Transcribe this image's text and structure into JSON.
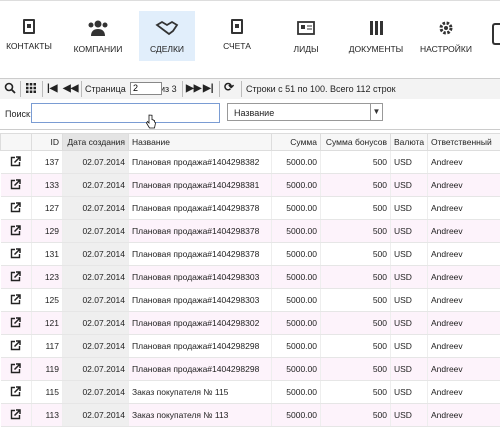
{
  "nav": {
    "items": [
      {
        "label": "КОНТАКТЫ",
        "icon": "contact-book-icon"
      },
      {
        "label": "КОМПАНИИ",
        "icon": "group-icon"
      },
      {
        "label": "СДЕЛКИ",
        "icon": "handshake-icon"
      },
      {
        "label": "СЧЕТА",
        "icon": "invoice-icon"
      },
      {
        "label": "ЛИДЫ",
        "icon": "lead-card-icon"
      },
      {
        "label": "ДОКУМЕНТЫ",
        "icon": "documents-icon"
      },
      {
        "label": "НАСТРОЙКИ",
        "icon": "gear-icon"
      }
    ],
    "active_index": 2
  },
  "toolbar": {
    "page_label": "Страница",
    "page_value": "2",
    "page_of": "из 3",
    "status": "Строки с 51 по 100. Всего 112 строк"
  },
  "search": {
    "label": "Поиск:",
    "value": "",
    "field_select": "Название"
  },
  "table": {
    "columns": [
      "ID",
      "Дата создания",
      "Название",
      "Сумма",
      "Сумма бонусов",
      "Валюта",
      "Ответственный"
    ],
    "rows": [
      {
        "id": "137",
        "date": "02.07.2014",
        "name": "Плановая продажа#1404298382",
        "sum": "5000.00",
        "bonus": "500",
        "currency": "USD",
        "resp": "Andreev"
      },
      {
        "id": "133",
        "date": "02.07.2014",
        "name": "Плановая продажа#1404298381",
        "sum": "5000.00",
        "bonus": "500",
        "currency": "USD",
        "resp": "Andreev"
      },
      {
        "id": "127",
        "date": "02.07.2014",
        "name": "Плановая продажа#1404298378",
        "sum": "5000.00",
        "bonus": "500",
        "currency": "USD",
        "resp": "Andreev"
      },
      {
        "id": "129",
        "date": "02.07.2014",
        "name": "Плановая продажа#1404298378",
        "sum": "5000.00",
        "bonus": "500",
        "currency": "USD",
        "resp": "Andreev"
      },
      {
        "id": "131",
        "date": "02.07.2014",
        "name": "Плановая продажа#1404298378",
        "sum": "5000.00",
        "bonus": "500",
        "currency": "USD",
        "resp": "Andreev"
      },
      {
        "id": "123",
        "date": "02.07.2014",
        "name": "Плановая продажа#1404298303",
        "sum": "5000.00",
        "bonus": "500",
        "currency": "USD",
        "resp": "Andreev"
      },
      {
        "id": "125",
        "date": "02.07.2014",
        "name": "Плановая продажа#1404298303",
        "sum": "5000.00",
        "bonus": "500",
        "currency": "USD",
        "resp": "Andreev"
      },
      {
        "id": "121",
        "date": "02.07.2014",
        "name": "Плановая продажа#1404298302",
        "sum": "5000.00",
        "bonus": "500",
        "currency": "USD",
        "resp": "Andreev"
      },
      {
        "id": "117",
        "date": "02.07.2014",
        "name": "Плановая продажа#1404298298",
        "sum": "5000.00",
        "bonus": "500",
        "currency": "USD",
        "resp": "Andreev"
      },
      {
        "id": "119",
        "date": "02.07.2014",
        "name": "Плановая продажа#1404298298",
        "sum": "5000.00",
        "bonus": "500",
        "currency": "USD",
        "resp": "Andreev"
      },
      {
        "id": "115",
        "date": "02.07.2014",
        "name": "Заказ покупателя № 115",
        "sum": "5000.00",
        "bonus": "500",
        "currency": "USD",
        "resp": "Andreev"
      },
      {
        "id": "113",
        "date": "02.07.2014",
        "name": "Заказ покупателя № 113",
        "sum": "5000.00",
        "bonus": "500",
        "currency": "USD",
        "resp": "Andreev"
      }
    ]
  },
  "colors": {
    "active_nav_bg": "#e1eefb",
    "row_alt_bg": "#fdf3fb",
    "date_col_bg": "#efefef"
  }
}
